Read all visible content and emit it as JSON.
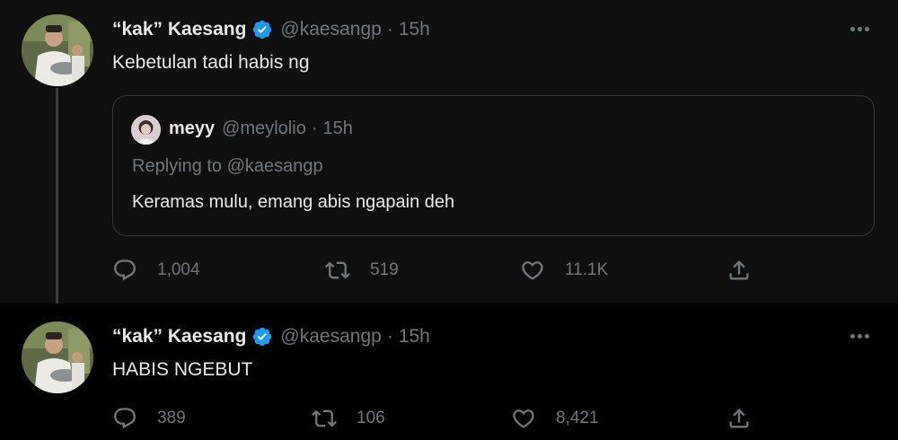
{
  "colors": {
    "background": "#000000",
    "text": "#e7e9ea",
    "secondary": "#71767b",
    "verified": "#1d9bf0",
    "border": "#33363b"
  },
  "tweets": [
    {
      "author": {
        "name": "“kak” Kaesang",
        "handle": "@kaesangp",
        "verified": true,
        "avatar_icon": "profile-photo-chef"
      },
      "time": "15h",
      "text": "Kebetulan tadi habis ng",
      "quoted": {
        "author": {
          "name": "meyy",
          "handle": "@meylolio",
          "avatar_icon": "profile-photo"
        },
        "time": "15h",
        "replying_prefix": "Replying to",
        "replying_to": "@kaesangp",
        "text": "Keramas mulu, emang abis ngapain deh"
      },
      "actions": {
        "replies": "1,004",
        "retweets": "519",
        "likes": "11.1K"
      }
    },
    {
      "author": {
        "name": "“kak” Kaesang",
        "handle": "@kaesangp",
        "verified": true,
        "avatar_icon": "profile-photo-chef"
      },
      "time": "15h",
      "text": "HABIS NGEBUT",
      "actions": {
        "replies": "389",
        "retweets": "106",
        "likes": "8,421"
      }
    }
  ],
  "icons": {
    "reply": "reply-icon",
    "retweet": "retweet-icon",
    "like": "heart-icon",
    "share": "share-icon",
    "more": "more-icon",
    "verified": "verified-badge-icon"
  },
  "separator": "·"
}
